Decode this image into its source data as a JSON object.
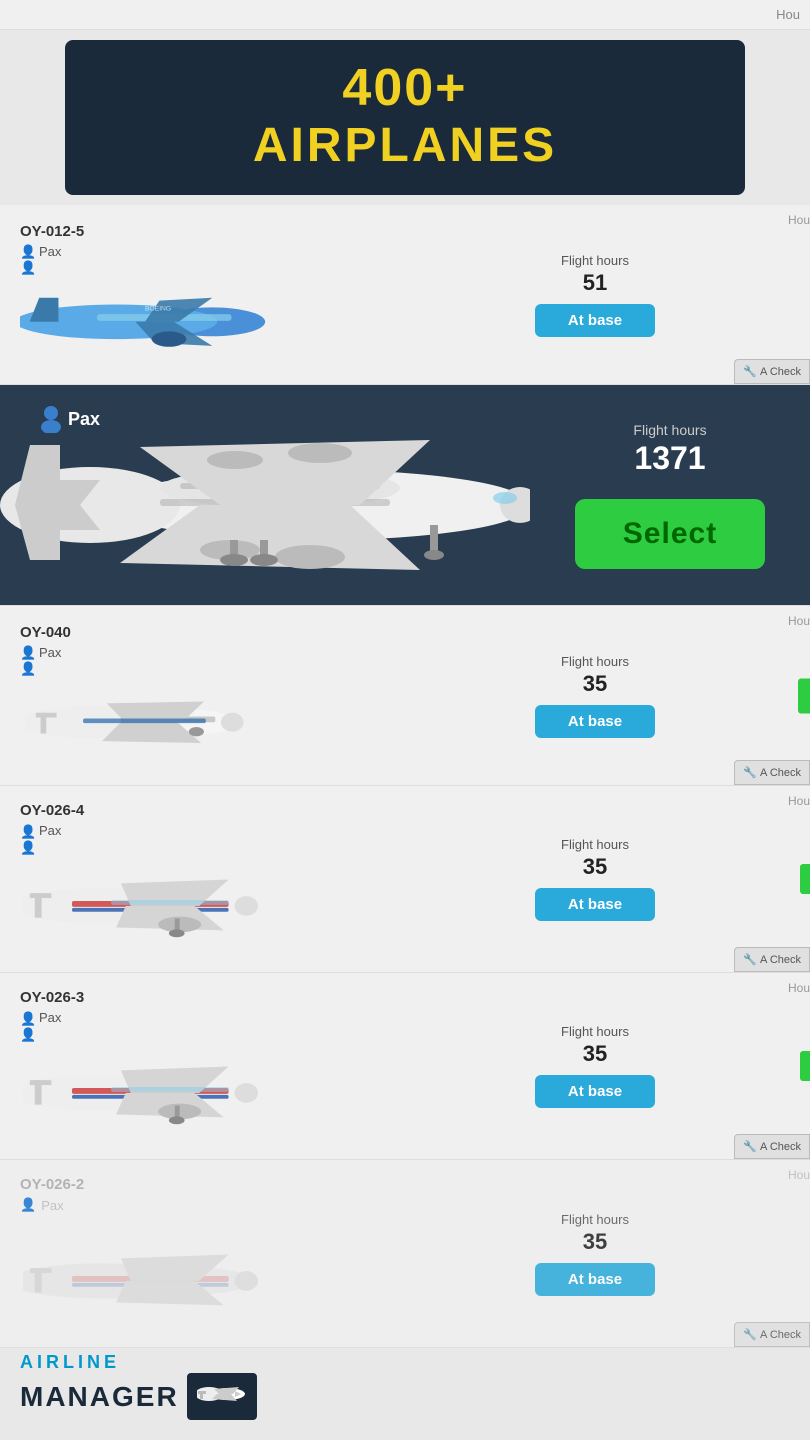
{
  "banner": {
    "line1": "400+",
    "line2": "AIRPLANES"
  },
  "partial_top_label": "Hou",
  "planes": [
    {
      "id": "OY-012-5",
      "type": "Pax",
      "flight_hours_label": "Flight hours",
      "flight_hours": "51",
      "status": "At base",
      "hours_right_label": "Hou",
      "a_check_label": "A Check",
      "highlighted": false,
      "has_green_dot": false
    },
    {
      "id": "",
      "type": "Pax",
      "flight_hours_label": "Flight hours",
      "flight_hours": "1371",
      "status_action": "Select",
      "highlighted": true,
      "has_green_dot": false
    },
    {
      "id": "OY-040",
      "type": "Pax",
      "flight_hours_label": "Flight hours",
      "flight_hours": "35",
      "status": "At base",
      "hours_right_label": "Hou",
      "a_check_label": "A Check",
      "highlighted": false,
      "has_green_dot": true
    },
    {
      "id": "OY-026-4",
      "type": "Pax",
      "flight_hours_label": "Flight hours",
      "flight_hours": "35",
      "status": "At base",
      "hours_right_label": "Hou",
      "a_check_label": "A Check",
      "highlighted": false,
      "has_green_dot": true
    },
    {
      "id": "OY-026-3",
      "type": "Pax",
      "flight_hours_label": "Flight hours",
      "flight_hours": "35",
      "status": "At base",
      "hours_right_label": "Hou",
      "a_check_label": "A Check",
      "highlighted": false,
      "has_green_dot": true
    },
    {
      "id": "OY-026-2",
      "type": "Pax",
      "flight_hours_label": "Flight hours",
      "flight_hours": "35",
      "status": "At base",
      "hours_right_label": "Hou",
      "a_check_label": "A Check",
      "highlighted": false,
      "has_green_dot": false
    }
  ],
  "logo": {
    "airline": "AIRLINE",
    "manager": "MANAGER"
  },
  "colors": {
    "banner_bg": "#1a2a3a",
    "banner_text": "#f0d020",
    "status_btn": "#29aadb",
    "select_btn": "#2ecc40",
    "highlighted_bg": "#2a3d50"
  }
}
